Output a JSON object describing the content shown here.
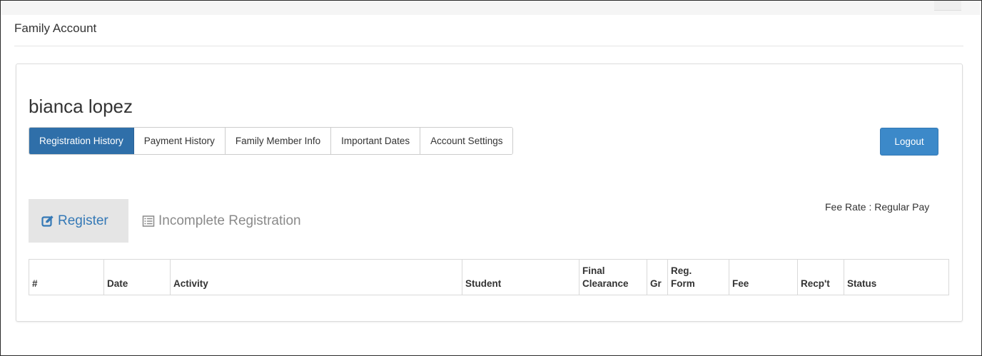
{
  "page": {
    "heading": "Family Account"
  },
  "account": {
    "user_name": "bianca lopez"
  },
  "tabs": [
    {
      "label": "Registration History",
      "active": true
    },
    {
      "label": "Payment History",
      "active": false
    },
    {
      "label": "Family Member Info",
      "active": false
    },
    {
      "label": "Important Dates",
      "active": false
    },
    {
      "label": "Account Settings",
      "active": false
    }
  ],
  "logout": {
    "label": "Logout"
  },
  "fee_rate": {
    "text": "Fee Rate : Regular Pay"
  },
  "actions": {
    "register": {
      "label": "Register",
      "icon": "edit-icon"
    },
    "incomplete": {
      "label": "Incomplete Registration",
      "icon": "list-icon"
    }
  },
  "table": {
    "headers": [
      {
        "line1": "",
        "line2": "#"
      },
      {
        "line1": "",
        "line2": "Date"
      },
      {
        "line1": "",
        "line2": "Activity"
      },
      {
        "line1": "",
        "line2": "Student"
      },
      {
        "line1": "Final",
        "line2": "Clearance"
      },
      {
        "line1": "",
        "line2": "Gr"
      },
      {
        "line1": "Reg.",
        "line2": "Form"
      },
      {
        "line1": "",
        "line2": "Fee"
      },
      {
        "line1": "",
        "line2": "Recp't"
      },
      {
        "line1": "",
        "line2": "Status"
      }
    ],
    "rows": []
  },
  "colors": {
    "active_tab": "#2f6fa9",
    "logout_button": "#3c89c9",
    "register_text": "#3579b6",
    "register_bg": "#e5e5e5",
    "muted_text": "#8a8a8a"
  }
}
